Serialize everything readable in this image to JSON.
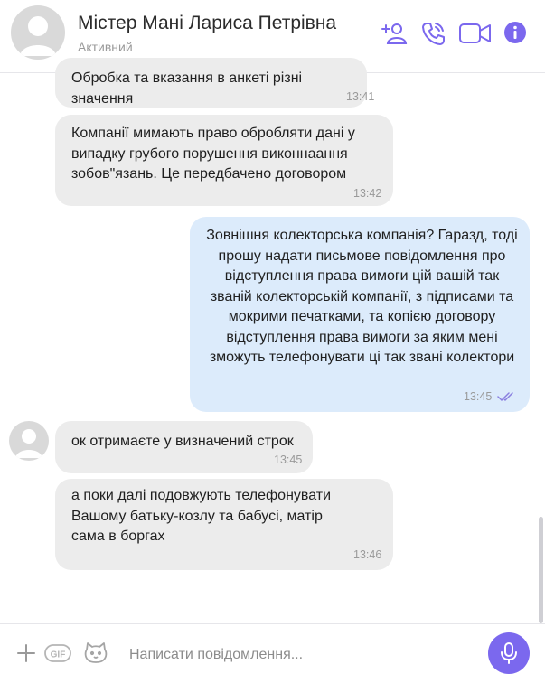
{
  "header": {
    "contact_name": "Містер Мані Лариса Петрівна",
    "status": "Активний",
    "icons": [
      "add-contact-icon",
      "phone-call-icon",
      "video-call-icon",
      "info-icon"
    ],
    "accent_color": "#7b68ee"
  },
  "messages": [
    {
      "direction": "in",
      "text": "Обробка та вказання в анкеті різні значення",
      "time": "13:41"
    },
    {
      "direction": "in",
      "text": "Компанії мимають право обробляти дані у випадку грубого порушення виконнаання зобов\"язань. Це передбачено договором",
      "time": "13:42"
    },
    {
      "direction": "out",
      "text": "Зовнішня колекторська компанія? Гаразд, тоді прошу надати письмове повідомлення про відступлення права вимоги цій вашій так званій колекторській компанії, з підписами та мокрими печатками, та копією договору відступлення права вимоги за яким мені зможуть телефонувати ці так звані колектори",
      "time": "13:45",
      "read": true
    },
    {
      "direction": "in",
      "text": "ок отримаєте у визначений строк",
      "time": "13:45"
    },
    {
      "direction": "in",
      "text": "а поки далі подовжують телефонувати Вашому батьку-козлу та бабусі, матір сама в боргах",
      "time": "13:46"
    }
  ],
  "composer": {
    "placeholder": "Написати повідомлення...",
    "gif_label": "GIF",
    "icons": [
      "plus-icon",
      "gif-icon",
      "sticker-icon",
      "microphone-icon"
    ]
  }
}
